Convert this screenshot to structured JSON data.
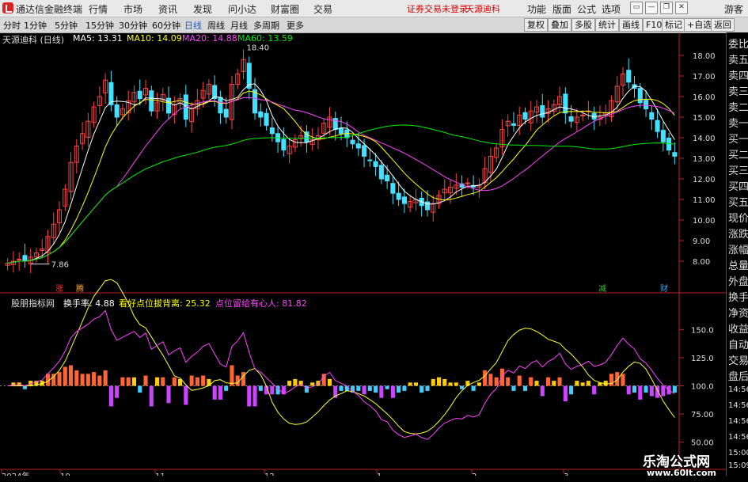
{
  "app": {
    "title": "通达信金融终端"
  },
  "menu": [
    "行情",
    "市场",
    "资讯",
    "发现",
    "问小达",
    "财富圈",
    "交易"
  ],
  "notice": {
    "text1": "证券交易未登录",
    "text2": "天源迪科"
  },
  "right_menu": [
    "功能",
    "版面",
    "公式",
    "选项"
  ],
  "window_controls": [
    "▭",
    "—",
    "❐",
    "✕"
  ],
  "guest": "游客",
  "periods": [
    "分时",
    "1分钟",
    "5分钟",
    "15分钟",
    "30分钟",
    "60分钟",
    "日线",
    "周线",
    "月线",
    "多周期",
    "更多"
  ],
  "active_period": "日线",
  "tool_buttons": [
    "复权",
    "叠加",
    "多股",
    "统计",
    "画线",
    "F10",
    "标记",
    "+自选",
    "返回"
  ],
  "stock": {
    "name": "天源迪科 (日线)"
  },
  "ma_legend": [
    {
      "label": "MA5: 13.31",
      "color": "#ffffff"
    },
    {
      "label": "MA10: 14.09",
      "color": "#ffff00"
    },
    {
      "label": "MA20: 14.88",
      "color": "#ff44ff"
    },
    {
      "label": "MA60: 13.59",
      "color": "#00ee00"
    }
  ],
  "price_axis": [
    "18.00",
    "17.00",
    "16.00",
    "15.00",
    "14.00",
    "13.00",
    "12.00",
    "11.00",
    "10.00",
    "9.00",
    "8.00"
  ],
  "price_labels": {
    "high": "18.40",
    "low": "7.86"
  },
  "markers": [
    {
      "text": "涨",
      "color": "#ff3333"
    },
    {
      "text": "腾",
      "color": "#ffaa33"
    },
    {
      "text": "减",
      "color": "#33cc33"
    },
    {
      "text": "财",
      "color": "#33aaff"
    }
  ],
  "sub_legend": [
    {
      "label": "股朋指标网",
      "color": "#dddddd"
    },
    {
      "label": "换手率: 4.88",
      "color": "#ffffff"
    },
    {
      "label": "看好点位拔背离: 25.32",
      "color": "#ffff00"
    },
    {
      "label": "点位留给有心人: 81.82",
      "color": "#ff44ff"
    }
  ],
  "sub_axis": [
    "150.0",
    "125.0",
    "100.0",
    "75.00",
    "50.00"
  ],
  "x_labels": [
    "2024年",
    "10",
    "11",
    "12",
    "1",
    "2",
    "3"
  ],
  "side_panel": [
    "委比",
    "卖五",
    "卖四",
    "卖三",
    "卖二",
    "卖一",
    "买一",
    "买二",
    "买三",
    "买四",
    "买五",
    "现价",
    "涨跌",
    "涨幅",
    "总量",
    "外盘",
    "换手",
    "净资",
    "收益",
    "自动",
    "交易",
    "盘后"
  ],
  "side_times": [
    "14:56",
    "14:56",
    "14:56",
    "14:56",
    "15:00",
    "15:09"
  ],
  "watermark": {
    "line1": "乐淘公式网",
    "line2": "www.60lt.com"
  },
  "colors": {
    "up": "#ff4444",
    "down": "#44e0ff",
    "ma5": "#ffffff",
    "ma10": "#ffff00",
    "ma20": "#ff44ff",
    "ma60": "#00ee00"
  },
  "chart_data": {
    "type": "candlestick",
    "close_series": [
      7.9,
      8.0,
      8.1,
      8.0,
      8.2,
      8.4,
      8.6,
      9.2,
      9.8,
      10.5,
      11.5,
      12.8,
      13.6,
      14.2,
      14.8,
      15.5,
      16.0,
      16.8,
      15.6,
      15.0,
      15.4,
      15.8,
      16.2,
      15.9,
      16.4,
      15.3,
      15.7,
      16.1,
      15.2,
      15.6,
      15.9,
      14.9,
      15.4,
      15.8,
      16.3,
      16.6,
      15.9,
      15.2,
      15.0,
      16.6,
      17.1,
      17.8,
      16.4,
      15.2,
      15.0,
      14.6,
      14.2,
      13.8,
      13.4,
      13.6,
      13.9,
      14.1,
      13.8,
      13.9,
      14.1,
      14.7,
      15.0,
      14.4,
      14.2,
      14.0,
      13.7,
      13.5,
      13.1,
      12.9,
      12.6,
      12.0,
      11.9,
      11.3,
      11.0,
      10.8,
      10.9,
      11.0,
      10.7,
      10.5,
      10.8,
      11.2,
      11.5,
      11.6,
      11.7,
      11.6,
      11.8,
      11.6,
      11.7,
      12.5,
      13.1,
      13.5,
      14.4,
      14.8,
      14.6,
      15.1,
      14.9,
      15.3,
      15.5,
      15.0,
      15.4,
      15.6,
      16.0,
      15.2,
      14.8,
      15.0,
      15.1,
      15.3,
      14.9,
      15.0,
      15.2,
      15.8,
      16.5,
      17.1,
      16.7,
      16.4,
      15.7,
      15.4,
      14.9,
      14.3,
      13.8,
      13.4,
      13.1
    ],
    "x_labels": [
      "2024年",
      "10",
      "11",
      "12",
      "1",
      "2",
      "3"
    ],
    "ylim": [
      7.5,
      18.5
    ]
  }
}
